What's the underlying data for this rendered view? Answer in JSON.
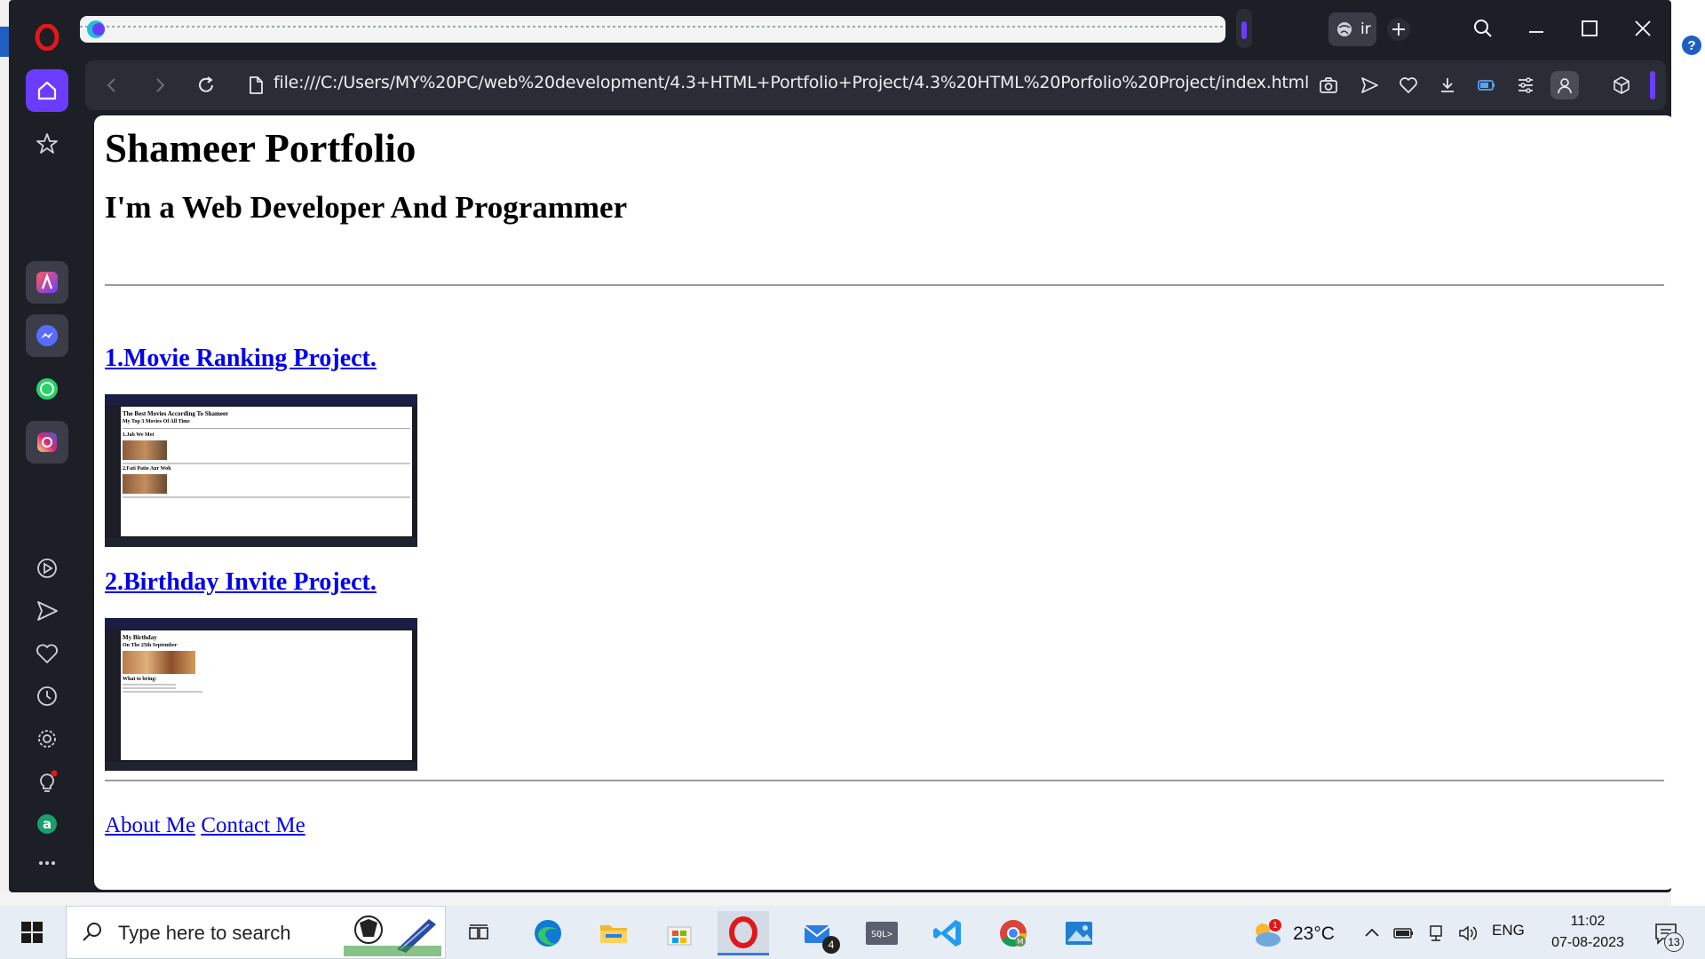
{
  "browser": {
    "url": "file:///C:/Users/MY%20PC/web%20development/4.3+HTML+Portfolio+Project/4.3%20HTML%20Porfolio%20Project/index.html",
    "tab_label": "ir",
    "new_tab_symbol": "+"
  },
  "page": {
    "title": "Shameer Portfolio",
    "subtitle": "I'm a Web Developer And Programmer",
    "projects": [
      {
        "link_text": "1.Movie Ranking Project.",
        "thumb": {
          "title": "The Best Movies According To Shameer",
          "sub": "My Top 3 Movies Of All Time",
          "item1": "1.Jab We Met",
          "item2": "2.Fati Patio Aur Woh"
        }
      },
      {
        "link_text": "2.Birthday Invite Project.",
        "thumb": {
          "title": "My Birthday",
          "sub": "On The 25th September",
          "item1": "What to bring:"
        }
      }
    ],
    "footer": {
      "about": "About Me",
      "contact": "Contact Me"
    }
  },
  "taskbar": {
    "search_placeholder": "Type here to search",
    "mail_badge": "4",
    "weather": "23°C",
    "weather_alert": "1",
    "language": "ENG",
    "time": "11:02",
    "date": "07-08-2023",
    "notifications": "13"
  },
  "colors": {
    "opera_red": "#e0181b",
    "accent_purple": "#6b3cff",
    "link_blue": "#0000ee"
  }
}
